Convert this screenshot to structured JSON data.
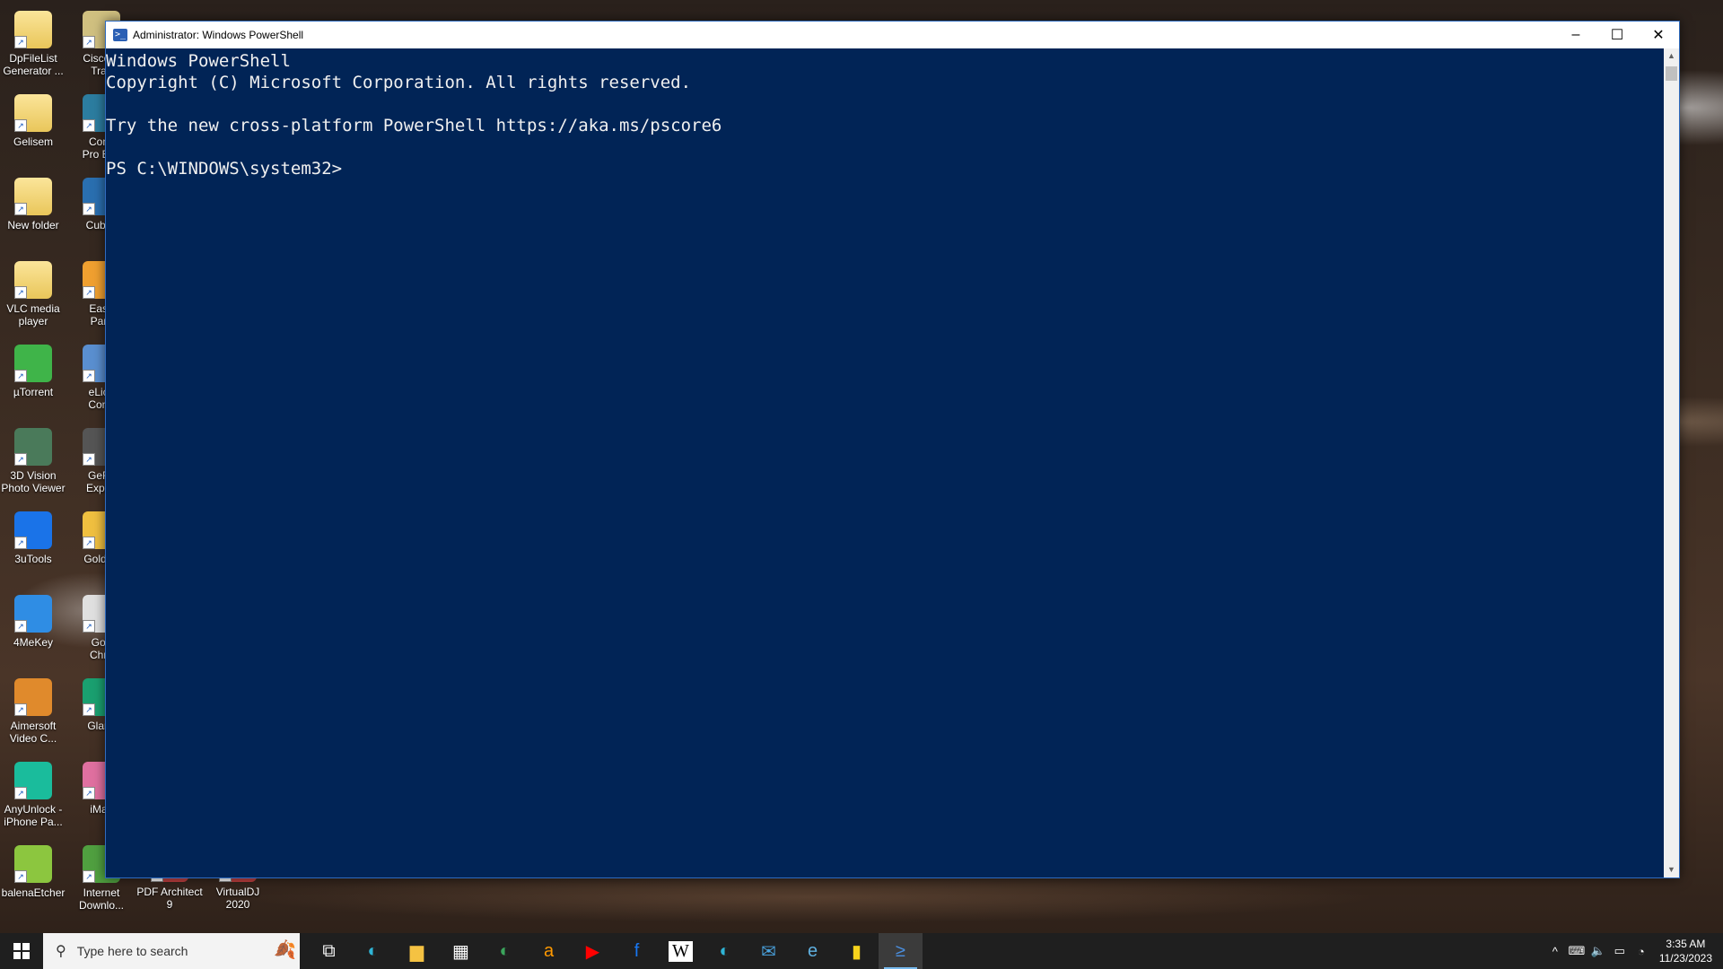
{
  "desktop": {
    "col1": [
      {
        "label": "DpFileList\nGenerator ...",
        "type": "folder"
      },
      {
        "label": "Gelisem",
        "type": "folder"
      },
      {
        "label": "New folder",
        "type": "folder"
      },
      {
        "label": "VLC media\nplayer",
        "type": "folder"
      },
      {
        "label": "µTorrent",
        "type": "app",
        "color": "#3fb449"
      },
      {
        "label": "3D Vision\nPhoto Viewer",
        "type": "app",
        "color": "#4a7a5a"
      },
      {
        "label": "3uTools",
        "type": "app",
        "color": "#1a73e8"
      },
      {
        "label": "4MeKey",
        "type": "app",
        "color": "#2f8de4"
      },
      {
        "label": "Aimersoft\nVideo C...",
        "type": "app",
        "color": "#e08a2c"
      },
      {
        "label": "AnyUnlock -\niPhone Pa...",
        "type": "app",
        "color": "#1abc9c"
      },
      {
        "label": "balenaEtcher",
        "type": "app",
        "color": "#8cc63f"
      }
    ],
    "col2": [
      {
        "label": "Cisco P\nTrac",
        "type": "app",
        "color": "#d0c080"
      },
      {
        "label": "Confi\nPro Evo",
        "type": "app",
        "color": "#2c7da0"
      },
      {
        "label": "Cubas",
        "type": "app",
        "color": "#2a6fb0"
      },
      {
        "label": "Ease\nParti",
        "type": "app",
        "color": "#f0a030"
      },
      {
        "label": "eLice\nContr",
        "type": "app",
        "color": "#5a8fd0"
      },
      {
        "label": "GeFo\nExperi",
        "type": "app",
        "color": "#555555"
      },
      {
        "label": "Gold Tr",
        "type": "app",
        "color": "#f0c040"
      },
      {
        "label": "Goo\nChro",
        "type": "app",
        "color": "#e0e0e0"
      },
      {
        "label": "Glami",
        "type": "app",
        "color": "#1aa070"
      },
      {
        "label": "iMaz",
        "type": "app",
        "color": "#e070a0"
      },
      {
        "label": "Internet\nDownlo...",
        "type": "app",
        "color": "#50a040"
      }
    ],
    "bottom_row": [
      {
        "label": "PDF Architect\n9"
      },
      {
        "label": "VirtualDJ\n2020"
      }
    ]
  },
  "window": {
    "title": "Administrator: Windows PowerShell",
    "minimize": "–",
    "maximize": "☐",
    "close": "✕",
    "lines": [
      "Windows PowerShell",
      "Copyright (C) Microsoft Corporation. All rights reserved.",
      "",
      "Try the new cross-platform PowerShell https://aka.ms/pscore6",
      "",
      "PS C:\\WINDOWS\\system32>"
    ]
  },
  "taskbar": {
    "search_placeholder": "Type here to search",
    "apps": [
      {
        "name": "task-view",
        "glyph": "⧉",
        "color": "#ffffff"
      },
      {
        "name": "edge",
        "glyph": "◐",
        "color": "#2fb5d6"
      },
      {
        "name": "file-explorer",
        "glyph": "▆",
        "color": "#f5c242"
      },
      {
        "name": "store",
        "glyph": "▦",
        "color": "#ffffff"
      },
      {
        "name": "edge-dev",
        "glyph": "◐",
        "color": "#3ba55c"
      },
      {
        "name": "amazon",
        "glyph": "a",
        "color": "#ff9900"
      },
      {
        "name": "youtube",
        "glyph": "▶",
        "color": "#ff0000"
      },
      {
        "name": "facebook",
        "glyph": "f",
        "color": "#1877f2"
      },
      {
        "name": "wikipedia",
        "glyph": "W",
        "color": "#000000"
      },
      {
        "name": "edge-beta",
        "glyph": "◐",
        "color": "#2fb5d6"
      },
      {
        "name": "mail",
        "glyph": "✉",
        "color": "#4aa3df"
      },
      {
        "name": "ie",
        "glyph": "e",
        "color": "#5fb0e0"
      },
      {
        "name": "sticky-notes",
        "glyph": "▮",
        "color": "#f7d31c"
      },
      {
        "name": "powershell",
        "glyph": "≥",
        "color": "#4a8fe0",
        "active": true
      }
    ],
    "time": "3:35 AM",
    "date": "11/23/2023"
  }
}
